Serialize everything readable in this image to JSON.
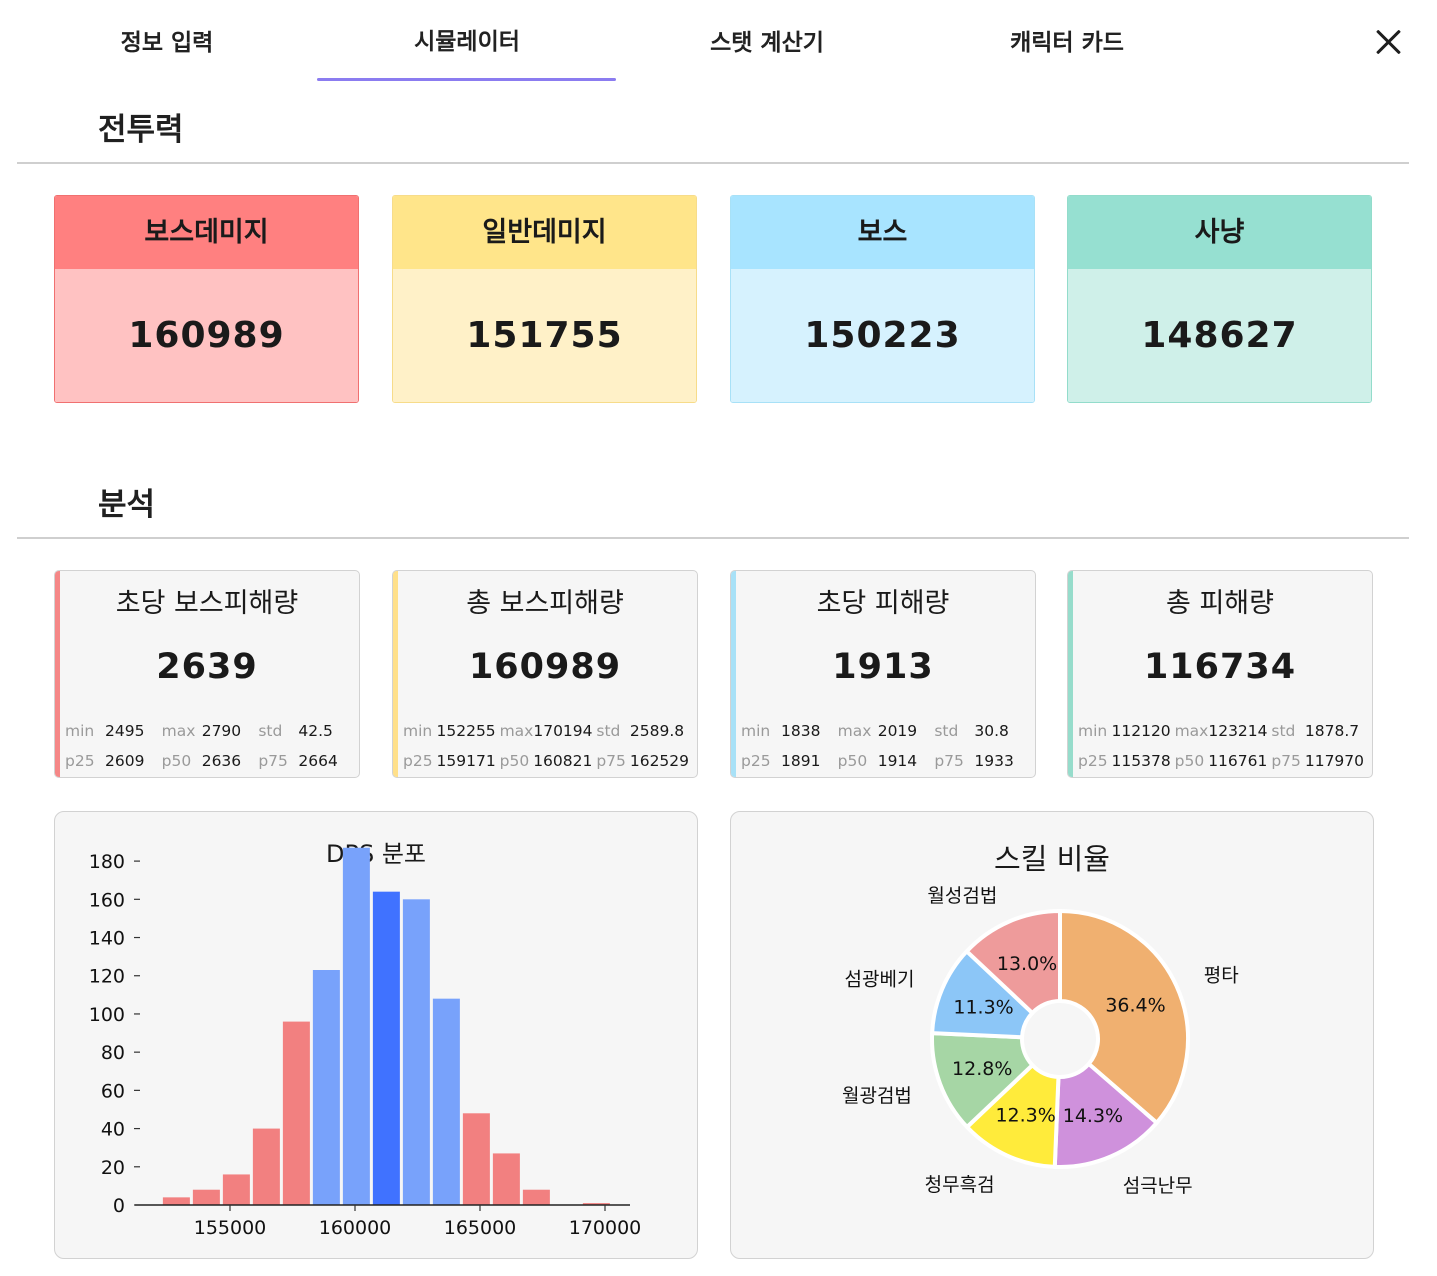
{
  "tabs": [
    {
      "label": "정보 입력",
      "active": false
    },
    {
      "label": "시뮬레이터",
      "active": true
    },
    {
      "label": "스탯 계산기",
      "active": false
    },
    {
      "label": "캐릭터 카드",
      "active": false
    }
  ],
  "close_icon": "close-icon",
  "combat_power": {
    "title": "전투력",
    "cards": [
      {
        "label": "보스데미지",
        "value": "160989",
        "head_color": "#ff8080",
        "body_color": "#ffc2c2",
        "border_color": "#f07070"
      },
      {
        "label": "일반데미지",
        "value": "151755",
        "head_color": "#ffe58a",
        "body_color": "#fff1c8",
        "border_color": "#f7dc8a"
      },
      {
        "label": "보스",
        "value": "150223",
        "head_color": "#a8e4ff",
        "body_color": "#d6f2fe",
        "border_color": "#a8e1f7"
      },
      {
        "label": "사냥",
        "value": "148627",
        "head_color": "#96e0d1",
        "body_color": "#cff0e9",
        "border_color": "#93dccb"
      }
    ]
  },
  "analysis": {
    "title": "분석",
    "cards": [
      {
        "title": "초당 보스피해량",
        "value": "2639",
        "accent": "#f58787",
        "min": "2495",
        "max": "2790",
        "std": "42.5",
        "p25": "2609",
        "p50": "2636",
        "p75": "2664"
      },
      {
        "title": "총 보스피해량",
        "value": "160989",
        "accent": "#ffe08a",
        "min": "152255",
        "max": "170194",
        "std": "2589.8",
        "p25": "159171",
        "p50": "160821",
        "p75": "162529"
      },
      {
        "title": "초당 피해량",
        "value": "1913",
        "accent": "#a8e1f7",
        "min": "1838",
        "max": "2019",
        "std": "30.8",
        "p25": "1891",
        "p50": "1914",
        "p75": "1933"
      },
      {
        "title": "총 피해량",
        "value": "116734",
        "accent": "#96dccb",
        "min": "112120",
        "max": "123214",
        "std": "1878.7",
        "p25": "115378",
        "p50": "116761",
        "p75": "117970"
      }
    ],
    "stat_keys": {
      "min": "min",
      "max": "max",
      "std": "std",
      "p25": "p25",
      "p50": "p50",
      "p75": "p75"
    }
  },
  "chart_data": [
    {
      "type": "bar",
      "title": "DPS 분포",
      "xlabel": "",
      "ylabel": "",
      "x_ticks": [
        "155000",
        "160000",
        "165000",
        "170000"
      ],
      "y_ticks": [
        "0",
        "20",
        "40",
        "60",
        "80",
        "100",
        "120",
        "140",
        "160",
        "180"
      ],
      "xlim": [
        151200,
        171000
      ],
      "ylim": [
        0,
        190
      ],
      "bin_width": 1200,
      "bins": [
        {
          "start": 152255,
          "count": 4,
          "color": "#f28080"
        },
        {
          "start": 153455,
          "count": 8,
          "color": "#f28080"
        },
        {
          "start": 154655,
          "count": 16,
          "color": "#f28080"
        },
        {
          "start": 155855,
          "count": 40,
          "color": "#f28080"
        },
        {
          "start": 157055,
          "count": 96,
          "color": "#f28080"
        },
        {
          "start": 158255,
          "count": 123,
          "color": "#78a2fb"
        },
        {
          "start": 159455,
          "count": 187,
          "color": "#78a2fb"
        },
        {
          "start": 160655,
          "count": 164,
          "color": "#4072ff"
        },
        {
          "start": 161855,
          "count": 160,
          "color": "#78a2fb"
        },
        {
          "start": 163055,
          "count": 108,
          "color": "#78a2fb"
        },
        {
          "start": 164255,
          "count": 48,
          "color": "#f28080"
        },
        {
          "start": 165455,
          "count": 27,
          "color": "#f28080"
        },
        {
          "start": 166655,
          "count": 8,
          "color": "#f28080"
        },
        {
          "start": 167855,
          "count": 0,
          "color": "#f28080"
        },
        {
          "start": 169055,
          "count": 1,
          "color": "#f28080"
        }
      ],
      "grid": false
    },
    {
      "type": "pie",
      "title": "스킬 비율",
      "donut": true,
      "slices": [
        {
          "label": "평타",
          "value": 36.4,
          "text": "36.4%",
          "color": "#f0b070"
        },
        {
          "label": "섬극난무",
          "value": 14.3,
          "text": "14.3%",
          "color": "#cf91dc"
        },
        {
          "label": "청무흑검",
          "value": 12.3,
          "text": "12.3%",
          "color": "#ffeb3b"
        },
        {
          "label": "월광검법",
          "value": 12.8,
          "text": "12.8%",
          "color": "#a6d6a5"
        },
        {
          "label": "섬광베기",
          "value": 11.3,
          "text": "11.3%",
          "color": "#8cc6f7"
        },
        {
          "label": "월성검법",
          "value": 13.0,
          "text": "13.0%",
          "color": "#ee9b9b"
        }
      ]
    }
  ]
}
